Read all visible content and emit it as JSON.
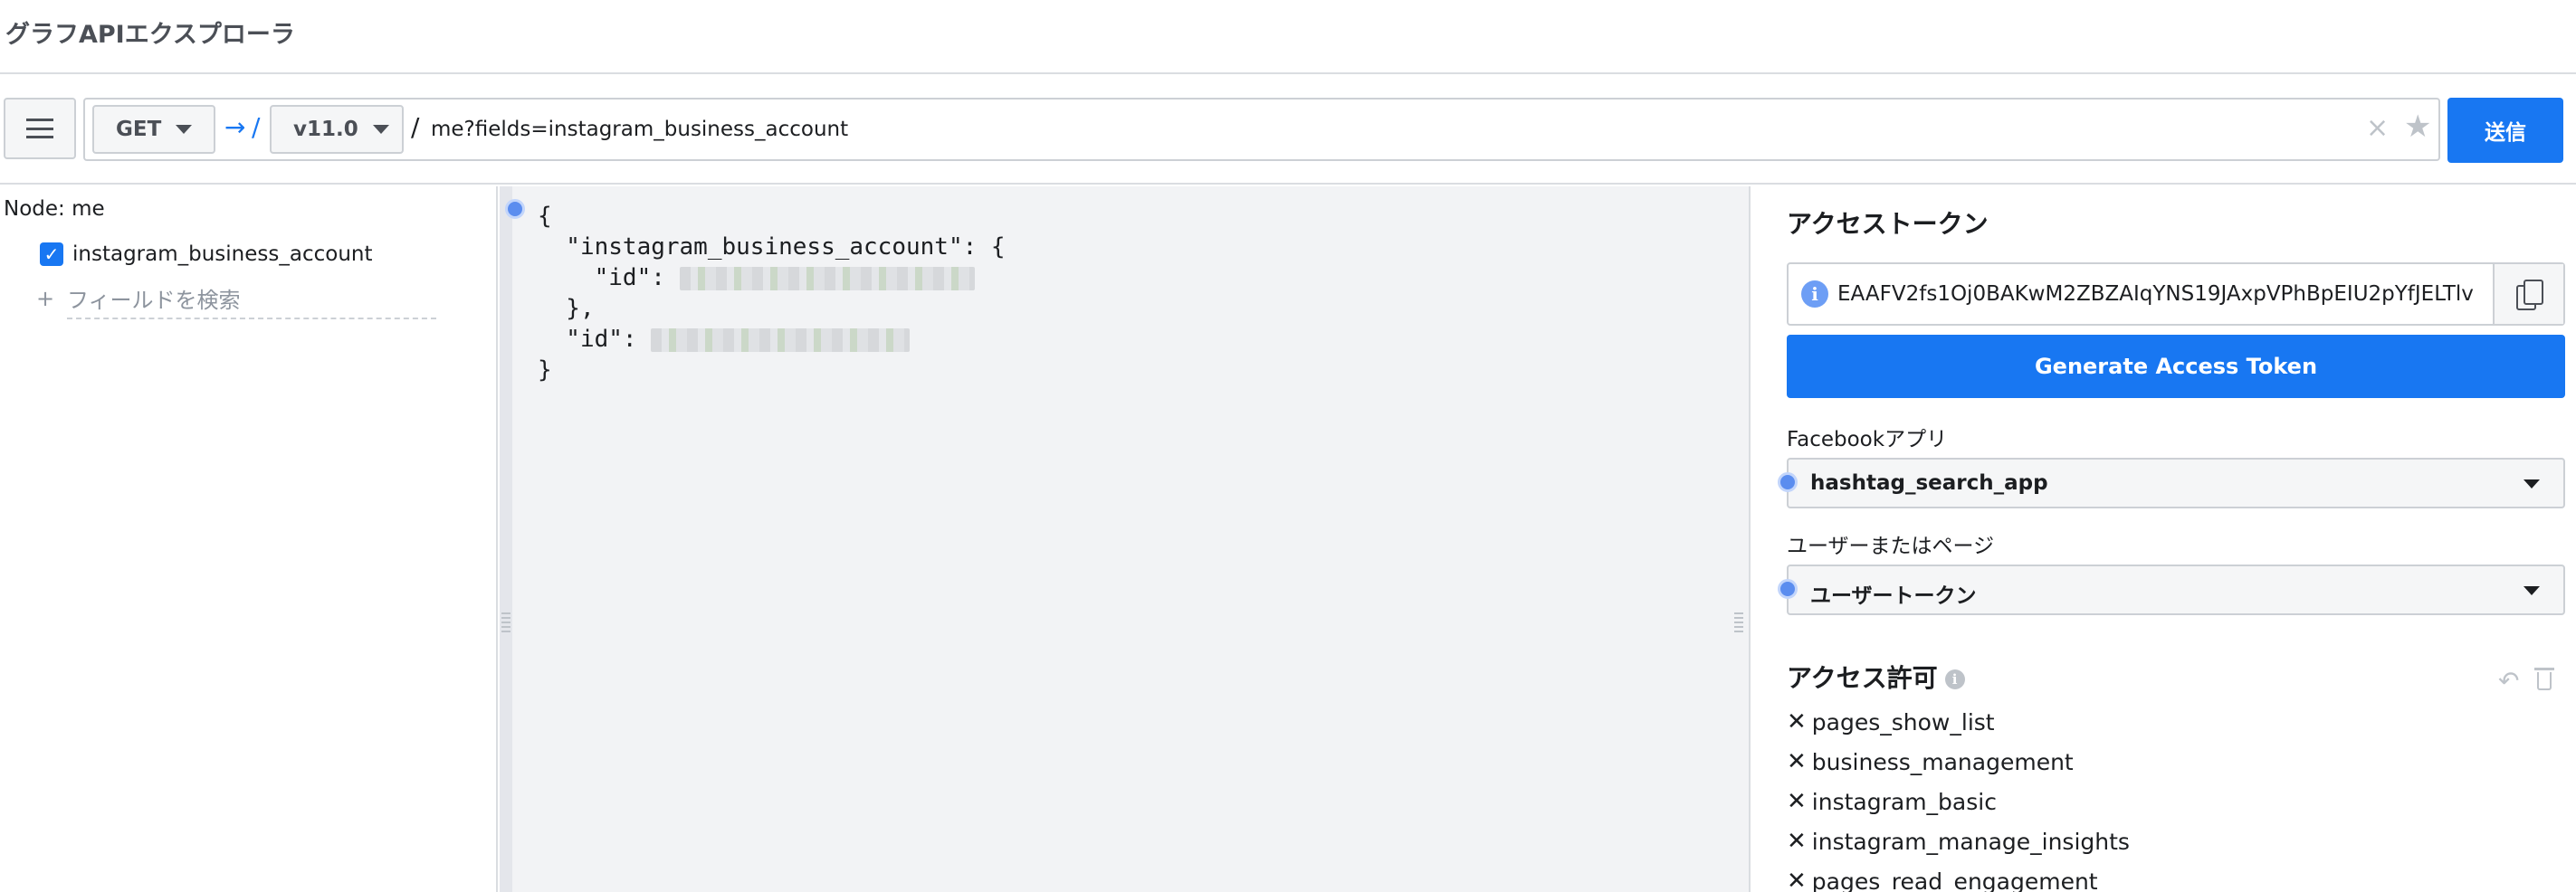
{
  "app": {
    "title": "グラフAPIエクスプローラ"
  },
  "request": {
    "method": "GET",
    "version": "v11.0",
    "arrow": "→",
    "slash": "/",
    "path": "me?fields=instagram_business_account",
    "send_label": "送信",
    "clear_glyph": "×",
    "star_glyph": "★"
  },
  "fields": {
    "node_label": "Node:  me",
    "items": [
      {
        "label": "instagram_business_account",
        "checked": true
      }
    ],
    "search_placeholder": "フィールドを検索",
    "plus_glyph": "+"
  },
  "response": {
    "line1": "{",
    "line2": "  \"instagram_business_account\": {",
    "line3": "    \"id\": ",
    "line4": "  },",
    "line5": "  \"id\": ",
    "line6": "}"
  },
  "token_panel": {
    "title": "アクセストークン",
    "token": "EAAFV2fs1Oj0BAKwM2ZBZAIqYNS19JAxpVPhBpEIU2pYfJELTlv",
    "generate_label": "Generate Access Token",
    "app_label": "Facebookアプリ",
    "app_value": "hashtag_search_app",
    "user_label": "ユーザーまたはページ",
    "user_value": "ユーザートークン"
  },
  "permissions": {
    "title": "アクセス許可",
    "info_glyph": "i",
    "undo_glyph": "↶",
    "remove_glyph": "✕",
    "items": [
      "pages_show_list",
      "business_management",
      "instagram_basic",
      "instagram_manage_insights",
      "pages_read_engagement"
    ]
  },
  "colors": {
    "accent": "#1877f2",
    "border": "#ccd0d5",
    "pane_bg": "#f2f3f5"
  }
}
